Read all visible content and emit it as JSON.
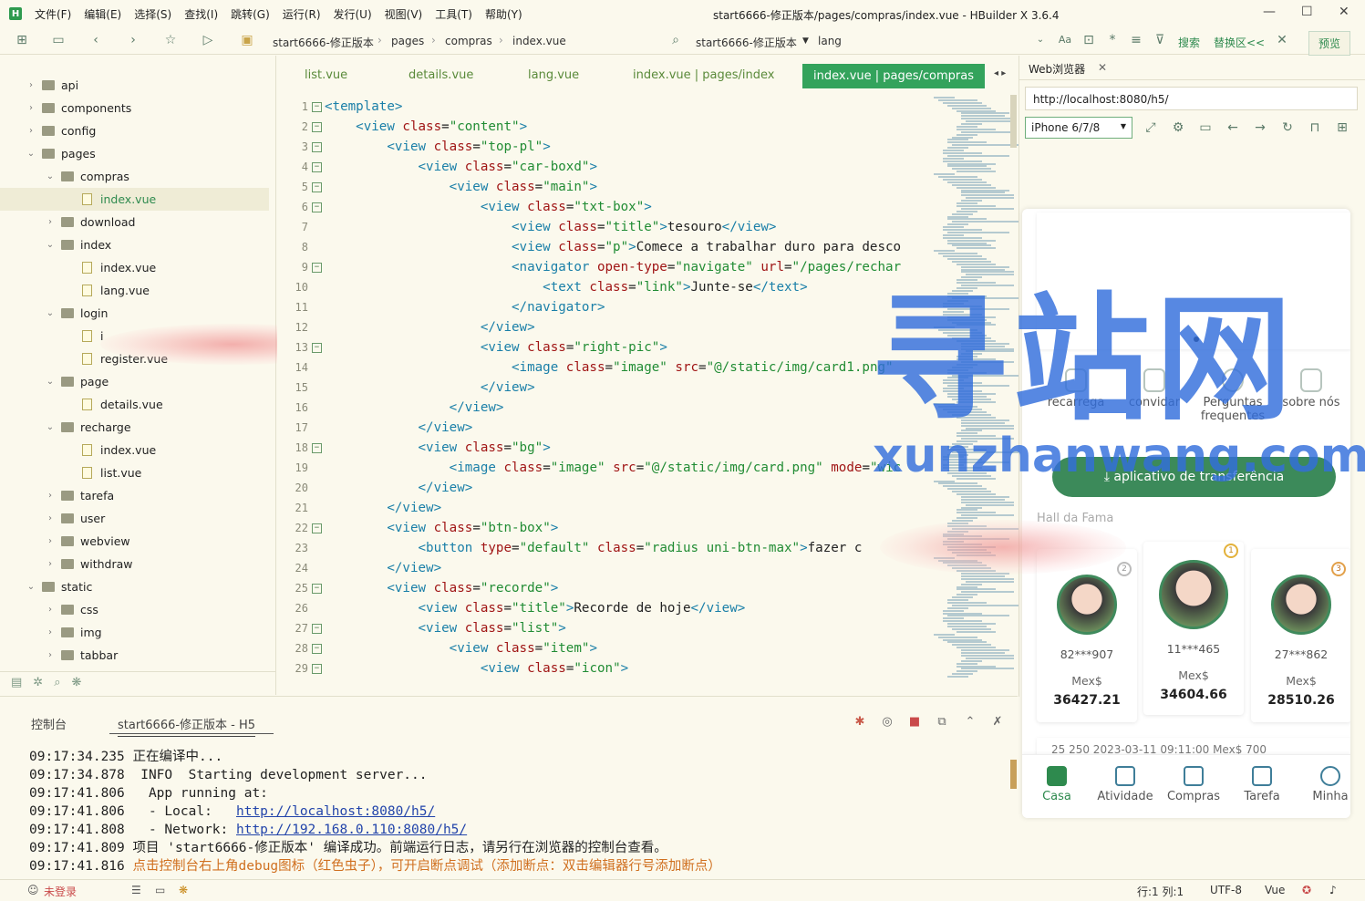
{
  "window": {
    "title": "start6666-修正版本/pages/compras/index.vue - HBuilder X 3.6.4",
    "menu": [
      "文件(F)",
      "编辑(E)",
      "选择(S)",
      "查找(I)",
      "跳转(G)",
      "运行(R)",
      "发行(U)",
      "视图(V)",
      "工具(T)",
      "帮助(Y)"
    ]
  },
  "toolbar": {
    "breadcrumb": [
      "start6666-修正版本",
      "pages",
      "compras",
      "index.vue"
    ],
    "project_selector": "start6666-修正版本",
    "search_value": "lang",
    "search_label": "搜索",
    "replace_label": "替换区<<",
    "preview_label": "预览"
  },
  "sidebar": {
    "items": [
      {
        "label": "api",
        "type": "folder",
        "open": false,
        "depth": 0
      },
      {
        "label": "components",
        "type": "folder",
        "open": false,
        "depth": 0
      },
      {
        "label": "config",
        "type": "folder",
        "open": false,
        "depth": 0
      },
      {
        "label": "pages",
        "type": "folder",
        "open": true,
        "depth": 0
      },
      {
        "label": "compras",
        "type": "folder",
        "open": true,
        "depth": 1
      },
      {
        "label": "index.vue",
        "type": "file",
        "depth": 2,
        "selected": true
      },
      {
        "label": "download",
        "type": "folder",
        "open": false,
        "depth": 1
      },
      {
        "label": "index",
        "type": "folder",
        "open": true,
        "depth": 1
      },
      {
        "label": "index.vue",
        "type": "file",
        "depth": 2
      },
      {
        "label": "lang.vue",
        "type": "file",
        "depth": 2
      },
      {
        "label": "login",
        "type": "folder",
        "open": true,
        "depth": 1
      },
      {
        "label": "i",
        "type": "file",
        "depth": 2
      },
      {
        "label": "register.vue",
        "type": "file",
        "depth": 2
      },
      {
        "label": "page",
        "type": "folder",
        "open": true,
        "depth": 1
      },
      {
        "label": "details.vue",
        "type": "file",
        "depth": 2
      },
      {
        "label": "recharge",
        "type": "folder",
        "open": true,
        "depth": 1
      },
      {
        "label": "index.vue",
        "type": "file",
        "depth": 2
      },
      {
        "label": "list.vue",
        "type": "file",
        "depth": 2
      },
      {
        "label": "tarefa",
        "type": "folder",
        "open": false,
        "depth": 1
      },
      {
        "label": "user",
        "type": "folder",
        "open": false,
        "depth": 1
      },
      {
        "label": "webview",
        "type": "folder",
        "open": false,
        "depth": 1
      },
      {
        "label": "withdraw",
        "type": "folder",
        "open": false,
        "depth": 1
      },
      {
        "label": "static",
        "type": "folder",
        "open": true,
        "depth": 0
      },
      {
        "label": "css",
        "type": "folder",
        "open": false,
        "depth": 1
      },
      {
        "label": "img",
        "type": "folder",
        "open": false,
        "depth": 1
      },
      {
        "label": "tabbar",
        "type": "folder",
        "open": false,
        "depth": 1
      }
    ]
  },
  "editor": {
    "tabs": [
      "list.vue",
      "details.vue",
      "lang.vue",
      "index.vue | pages/index",
      "index.vue | pages/compras"
    ],
    "active_tab": 4,
    "lines": [
      {
        "n": 1,
        "fold": true,
        "indent": 0,
        "parts": [
          [
            "t",
            "<template>"
          ]
        ]
      },
      {
        "n": 2,
        "fold": true,
        "indent": 1,
        "parts": [
          [
            "t",
            "<view "
          ],
          [
            "a",
            "class"
          ],
          [
            "x",
            "="
          ],
          [
            "v",
            "\"content\""
          ],
          [
            "t",
            ">"
          ]
        ]
      },
      {
        "n": 3,
        "fold": true,
        "indent": 2,
        "parts": [
          [
            "t",
            "<view "
          ],
          [
            "a",
            "class"
          ],
          [
            "x",
            "="
          ],
          [
            "v",
            "\"top-pl\""
          ],
          [
            "t",
            ">"
          ]
        ]
      },
      {
        "n": 4,
        "fold": true,
        "indent": 3,
        "parts": [
          [
            "t",
            "<view "
          ],
          [
            "a",
            "class"
          ],
          [
            "x",
            "="
          ],
          [
            "v",
            "\"car-boxd\""
          ],
          [
            "t",
            ">"
          ]
        ]
      },
      {
        "n": 5,
        "fold": true,
        "indent": 4,
        "parts": [
          [
            "t",
            "<view "
          ],
          [
            "a",
            "class"
          ],
          [
            "x",
            "="
          ],
          [
            "v",
            "\"main\""
          ],
          [
            "t",
            ">"
          ]
        ]
      },
      {
        "n": 6,
        "fold": true,
        "indent": 5,
        "parts": [
          [
            "t",
            "<view "
          ],
          [
            "a",
            "class"
          ],
          [
            "x",
            "="
          ],
          [
            "v",
            "\"txt-box\""
          ],
          [
            "t",
            ">"
          ]
        ]
      },
      {
        "n": 7,
        "fold": false,
        "indent": 6,
        "parts": [
          [
            "t",
            "<view "
          ],
          [
            "a",
            "class"
          ],
          [
            "x",
            "="
          ],
          [
            "v",
            "\"title\""
          ],
          [
            "t",
            ">"
          ],
          [
            "x",
            "tesouro"
          ],
          [
            "t",
            "</view>"
          ]
        ]
      },
      {
        "n": 8,
        "fold": false,
        "indent": 6,
        "parts": [
          [
            "t",
            "<view "
          ],
          [
            "a",
            "class"
          ],
          [
            "x",
            "="
          ],
          [
            "v",
            "\"p\""
          ],
          [
            "t",
            ">"
          ],
          [
            "x",
            "Comece a trabalhar duro para desco"
          ]
        ]
      },
      {
        "n": 9,
        "fold": true,
        "indent": 6,
        "parts": [
          [
            "t",
            "<navigator "
          ],
          [
            "a",
            "open-type"
          ],
          [
            "x",
            "="
          ],
          [
            "v",
            "\"navigate\""
          ],
          [
            "x",
            " "
          ],
          [
            "a",
            "url"
          ],
          [
            "x",
            "="
          ],
          [
            "v",
            "\"/pages/rechar"
          ]
        ]
      },
      {
        "n": 10,
        "fold": false,
        "indent": 7,
        "parts": [
          [
            "t",
            "<text "
          ],
          [
            "a",
            "class"
          ],
          [
            "x",
            "="
          ],
          [
            "v",
            "\"link\""
          ],
          [
            "t",
            ">"
          ],
          [
            "x",
            "Junte-se"
          ],
          [
            "t",
            "</text>"
          ]
        ]
      },
      {
        "n": 11,
        "fold": false,
        "indent": 6,
        "parts": [
          [
            "t",
            "</navigator>"
          ]
        ]
      },
      {
        "n": 12,
        "fold": false,
        "indent": 5,
        "parts": [
          [
            "t",
            "</view>"
          ]
        ]
      },
      {
        "n": 13,
        "fold": true,
        "indent": 5,
        "parts": [
          [
            "t",
            "<view "
          ],
          [
            "a",
            "class"
          ],
          [
            "x",
            "="
          ],
          [
            "v",
            "\"right-pic\""
          ],
          [
            "t",
            ">"
          ]
        ]
      },
      {
        "n": 14,
        "fold": false,
        "indent": 6,
        "parts": [
          [
            "t",
            "<image "
          ],
          [
            "a",
            "class"
          ],
          [
            "x",
            "="
          ],
          [
            "v",
            "\"image\""
          ],
          [
            "x",
            " "
          ],
          [
            "a",
            "src"
          ],
          [
            "x",
            "="
          ],
          [
            "v",
            "\"@/static/img/card1.png\""
          ]
        ]
      },
      {
        "n": 15,
        "fold": false,
        "indent": 5,
        "parts": [
          [
            "t",
            "</view>"
          ]
        ]
      },
      {
        "n": 16,
        "fold": false,
        "indent": 4,
        "parts": [
          [
            "t",
            "</view>"
          ]
        ]
      },
      {
        "n": 17,
        "fold": false,
        "indent": 3,
        "parts": [
          [
            "t",
            "</view>"
          ]
        ]
      },
      {
        "n": 18,
        "fold": true,
        "indent": 3,
        "parts": [
          [
            "t",
            "<view "
          ],
          [
            "a",
            "class"
          ],
          [
            "x",
            "="
          ],
          [
            "v",
            "\"bg\""
          ],
          [
            "t",
            ">"
          ]
        ]
      },
      {
        "n": 19,
        "fold": false,
        "indent": 4,
        "parts": [
          [
            "t",
            "<image "
          ],
          [
            "a",
            "class"
          ],
          [
            "x",
            "="
          ],
          [
            "v",
            "\"image\""
          ],
          [
            "x",
            " "
          ],
          [
            "a",
            "src"
          ],
          [
            "x",
            "="
          ],
          [
            "v",
            "\"@/static/img/card.png\""
          ],
          [
            "x",
            " "
          ],
          [
            "a",
            "mode"
          ],
          [
            "x",
            "="
          ],
          [
            "v",
            "\"wic"
          ]
        ]
      },
      {
        "n": 20,
        "fold": false,
        "indent": 3,
        "parts": [
          [
            "t",
            "</view>"
          ]
        ]
      },
      {
        "n": 21,
        "fold": false,
        "indent": 2,
        "parts": [
          [
            "t",
            "</view>"
          ]
        ]
      },
      {
        "n": 22,
        "fold": true,
        "indent": 2,
        "parts": [
          [
            "t",
            "<view "
          ],
          [
            "a",
            "class"
          ],
          [
            "x",
            "="
          ],
          [
            "v",
            "\"btn-box\""
          ],
          [
            "t",
            ">"
          ]
        ]
      },
      {
        "n": 23,
        "fold": false,
        "indent": 3,
        "parts": [
          [
            "t",
            "<button "
          ],
          [
            "a",
            "type"
          ],
          [
            "x",
            "="
          ],
          [
            "v",
            "\"default\""
          ],
          [
            "x",
            " "
          ],
          [
            "a",
            "class"
          ],
          [
            "x",
            "="
          ],
          [
            "v",
            "\"radius uni-btn-max\""
          ],
          [
            "t",
            ">"
          ],
          [
            "x",
            "fazer c"
          ]
        ]
      },
      {
        "n": 24,
        "fold": false,
        "indent": 2,
        "parts": [
          [
            "t",
            "</view>"
          ]
        ]
      },
      {
        "n": 25,
        "fold": true,
        "indent": 2,
        "parts": [
          [
            "t",
            "<view "
          ],
          [
            "a",
            "class"
          ],
          [
            "x",
            "="
          ],
          [
            "v",
            "\"recorde\""
          ],
          [
            "t",
            ">"
          ]
        ]
      },
      {
        "n": 26,
        "fold": false,
        "indent": 3,
        "parts": [
          [
            "t",
            "<view "
          ],
          [
            "a",
            "class"
          ],
          [
            "x",
            "="
          ],
          [
            "v",
            "\"title\""
          ],
          [
            "t",
            ">"
          ],
          [
            "x",
            "Recorde de hoje"
          ],
          [
            "t",
            "</view>"
          ]
        ]
      },
      {
        "n": 27,
        "fold": true,
        "indent": 3,
        "parts": [
          [
            "t",
            "<view "
          ],
          [
            "a",
            "class"
          ],
          [
            "x",
            "="
          ],
          [
            "v",
            "\"list\""
          ],
          [
            "t",
            ">"
          ]
        ]
      },
      {
        "n": 28,
        "fold": true,
        "indent": 4,
        "parts": [
          [
            "t",
            "<view "
          ],
          [
            "a",
            "class"
          ],
          [
            "x",
            "="
          ],
          [
            "v",
            "\"item\""
          ],
          [
            "t",
            ">"
          ]
        ]
      },
      {
        "n": 29,
        "fold": true,
        "indent": 5,
        "parts": [
          [
            "t",
            "<view "
          ],
          [
            "a",
            "class"
          ],
          [
            "x",
            "="
          ],
          [
            "v",
            "\"icon\""
          ],
          [
            "t",
            ">"
          ]
        ]
      }
    ]
  },
  "browser": {
    "tab_label": "Web浏览器",
    "url": "http://localhost:8080/h5/",
    "device": "iPhone 6/7/8",
    "app": {
      "quick_links": [
        "recarrega",
        "convidar",
        "Perguntas frequentes",
        "sobre nós"
      ],
      "transfer_button": "aplicativo de transferência",
      "hall_title": "Hall da Fama",
      "leaders": [
        {
          "name": "82***907",
          "currency": "Mex$",
          "amount": "36427.21",
          "rank": "2"
        },
        {
          "name": "11***465",
          "currency": "Mex$",
          "amount": "34604.66",
          "rank": "1"
        },
        {
          "name": "27***862",
          "currency": "Mex$",
          "amount": "28510.26",
          "rank": "3"
        }
      ],
      "record_strip": "25    250         2023-03-11 09:11:00       Mex$ 700",
      "tabbar": [
        "Casa",
        "Atividade",
        "Compras",
        "Tarefa",
        "Minha"
      ],
      "active_tab": 0
    }
  },
  "watermark": {
    "cn": "寻站网",
    "en": "xunzhanwang.com"
  },
  "console": {
    "tabs": [
      "控制台",
      "start6666-修正版本 - H5"
    ],
    "lines": [
      {
        "time": "09:17:34.235",
        "text": " 正在编译中..."
      },
      {
        "time": "09:17:34.878",
        "text": "  INFO  Starting development server..."
      },
      {
        "time": "09:17:41.806",
        "text": "   App running at:"
      },
      {
        "time": "09:17:41.806",
        "text": "   - Local:   ",
        "link": "http://localhost:8080/h5/"
      },
      {
        "time": "09:17:41.808",
        "text": "   - Network: ",
        "link": "http://192.168.0.110:8080/h5/"
      },
      {
        "time": "09:17:41.809",
        "text": " 项目 'start6666-修正版本' 编译成功。前端运行日志，请另行在浏览器的控制台查看。"
      },
      {
        "time": "09:17:41.816",
        "text": " ",
        "warn": "点击控制台右上角debug图标（红色虫子），可开启断点调试（添加断点：双击编辑器行号添加断点）"
      }
    ]
  },
  "statusbar": {
    "login": "未登录",
    "position": "行:1   列:1",
    "encoding": "UTF-8",
    "language": "Vue"
  },
  "colors": {
    "accent": "#2e8a4e",
    "background": "#fbf9ed",
    "tag": "#1a7fa8",
    "attr": "#a01515",
    "string": "#218c34"
  }
}
